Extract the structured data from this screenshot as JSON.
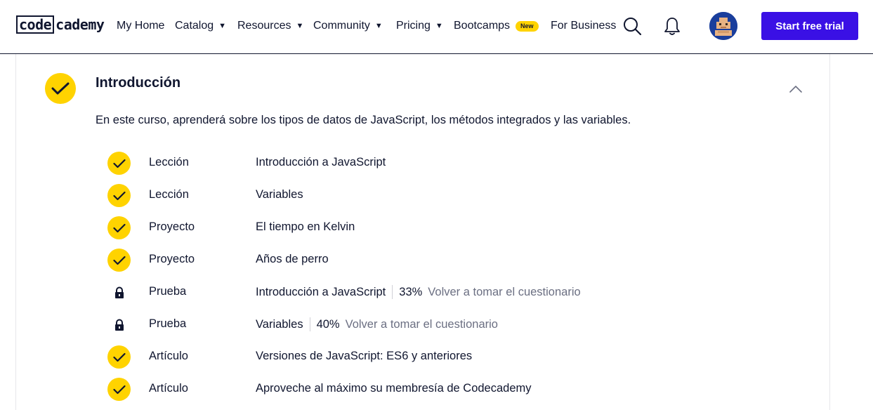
{
  "header": {
    "logo_code": "code",
    "logo_rest": "cademy",
    "nav": {
      "my_home": "My Home",
      "catalog": "Catalog",
      "resources": "Resources",
      "community": "Community",
      "pricing": "Pricing",
      "bootcamps": "Bootcamps",
      "bootcamps_badge": "New",
      "for_business": "For Business"
    },
    "cta": "Start free trial",
    "icons": [
      "search-icon",
      "bell-icon",
      "chevron-down-icon",
      "avatar"
    ]
  },
  "module": {
    "title": "Introducción",
    "description": "En este curso, aprenderá sobre los tipos de datos de JavaScript, los métodos integrados y las variables.",
    "items": [
      {
        "status": "complete",
        "type": "Lección",
        "name": "Introducción a JavaScript"
      },
      {
        "status": "complete",
        "type": "Lección",
        "name": "Variables"
      },
      {
        "status": "complete",
        "type": "Proyecto",
        "name": "El tiempo en Kelvin"
      },
      {
        "status": "complete",
        "type": "Proyecto",
        "name": "Años de perro"
      },
      {
        "status": "locked",
        "type": "Prueba",
        "name": "Introducción a JavaScript",
        "score": "33%",
        "retake": "Volver a tomar el cuestionario"
      },
      {
        "status": "locked",
        "type": "Prueba",
        "name": "Variables",
        "score": "40%",
        "retake": "Volver a tomar el cuestionario"
      },
      {
        "status": "complete",
        "type": "Artículo",
        "name": "Versiones de JavaScript: ES6 y anteriores"
      },
      {
        "status": "complete",
        "type": "Artículo",
        "name": "Aproveche al máximo su membresía de Codecademy"
      }
    ]
  },
  "colors": {
    "accent_yellow": "#ffd300",
    "cta_purple": "#3a10e5",
    "text_navy": "#10162f",
    "muted_gray": "#6b6f82"
  }
}
